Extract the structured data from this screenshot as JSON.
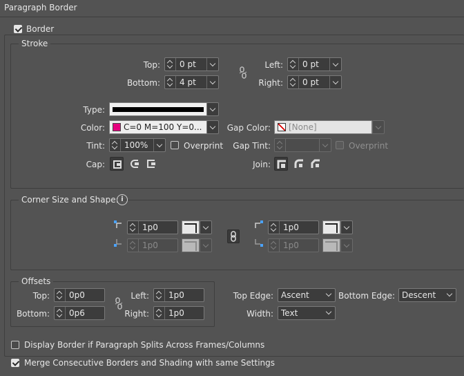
{
  "title": "Paragraph Border",
  "border_label": "Border",
  "stroke": {
    "legend": "Stroke",
    "top_label": "Top:",
    "top_value": "0 pt",
    "bottom_label": "Bottom:",
    "bottom_value": "4 pt",
    "left_label": "Left:",
    "left_value": "0 pt",
    "right_label": "Right:",
    "right_value": "0 pt",
    "type_label": "Type:",
    "color_label": "Color:",
    "color_value": "C=0 M=100 Y=0...",
    "color_swatch": "#e6007e",
    "gap_color_label": "Gap Color:",
    "gap_color_value": "[None]",
    "tint_label": "Tint:",
    "tint_value": "100%",
    "overprint_label": "Overprint",
    "gap_tint_label": "Gap Tint:",
    "gap_tint_value": "",
    "gap_overprint_label": "Overprint",
    "cap_label": "Cap:",
    "join_label": "Join:"
  },
  "corner": {
    "legend": "Corner Size and Shape:",
    "top_left_value": "1p0",
    "bottom_left_value": "1p0",
    "top_right_value": "1p0",
    "bottom_right_value": "1p0"
  },
  "offsets": {
    "legend": "Offsets",
    "top_label": "Top:",
    "top_value": "0p0",
    "bottom_label": "Bottom:",
    "bottom_value": "0p6",
    "left_label": "Left:",
    "left_value": "1p0",
    "right_label": "Right:",
    "right_value": "1p0"
  },
  "edges": {
    "top_edge_label": "Top Edge:",
    "top_edge_value": "Ascent",
    "bottom_edge_label": "Bottom Edge:",
    "bottom_edge_value": "Descent",
    "width_label": "Width:",
    "width_value": "Text"
  },
  "options": {
    "split_label": "Display Border if Paragraph Splits Across Frames/Columns",
    "merge_label": "Merge Consecutive Borders and Shading with same Settings"
  }
}
